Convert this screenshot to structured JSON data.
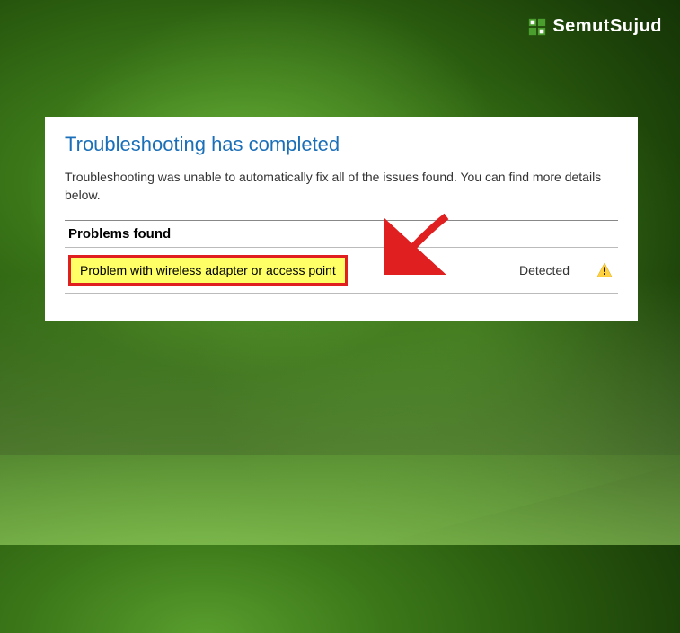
{
  "watermark": {
    "brand": "SemutSujud"
  },
  "dialog": {
    "title": "Troubleshooting has completed",
    "description": "Troubleshooting was unable to automatically fix all of the issues found. You can find more details below.",
    "problems_header": "Problems found",
    "problem": {
      "label": "Problem with wireless adapter or access point",
      "status": "Detected"
    }
  }
}
